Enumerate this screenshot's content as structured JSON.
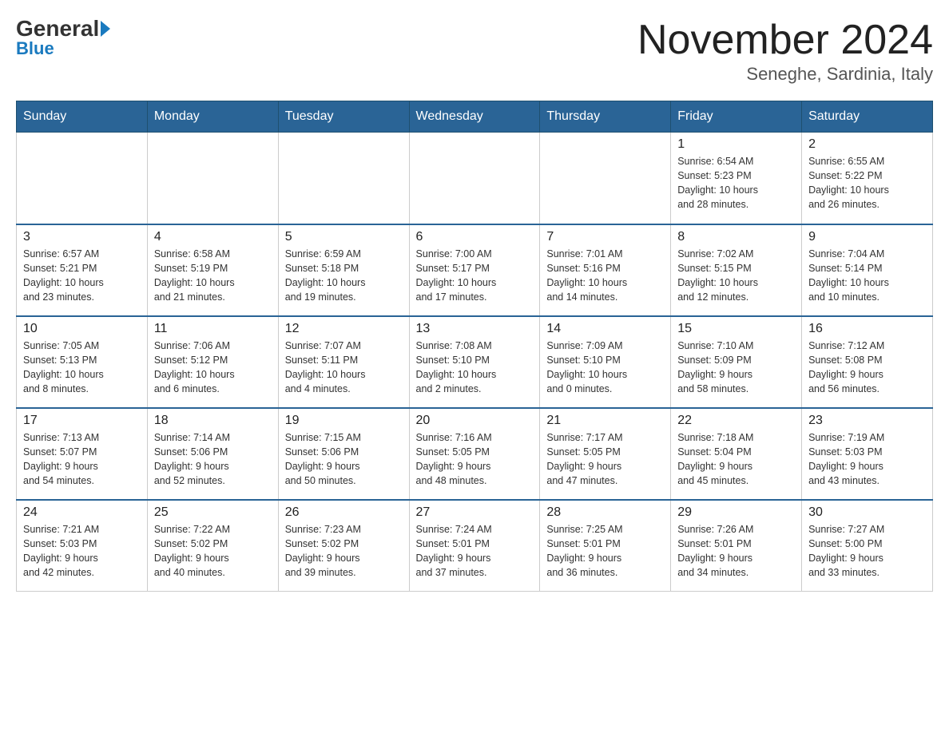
{
  "header": {
    "logo_general": "General",
    "logo_blue": "Blue",
    "month_title": "November 2024",
    "location": "Seneghe, Sardinia, Italy"
  },
  "days_of_week": [
    "Sunday",
    "Monday",
    "Tuesday",
    "Wednesday",
    "Thursday",
    "Friday",
    "Saturday"
  ],
  "weeks": [
    [
      {
        "day": "",
        "info": ""
      },
      {
        "day": "",
        "info": ""
      },
      {
        "day": "",
        "info": ""
      },
      {
        "day": "",
        "info": ""
      },
      {
        "day": "",
        "info": ""
      },
      {
        "day": "1",
        "info": "Sunrise: 6:54 AM\nSunset: 5:23 PM\nDaylight: 10 hours\nand 28 minutes."
      },
      {
        "day": "2",
        "info": "Sunrise: 6:55 AM\nSunset: 5:22 PM\nDaylight: 10 hours\nand 26 minutes."
      }
    ],
    [
      {
        "day": "3",
        "info": "Sunrise: 6:57 AM\nSunset: 5:21 PM\nDaylight: 10 hours\nand 23 minutes."
      },
      {
        "day": "4",
        "info": "Sunrise: 6:58 AM\nSunset: 5:19 PM\nDaylight: 10 hours\nand 21 minutes."
      },
      {
        "day": "5",
        "info": "Sunrise: 6:59 AM\nSunset: 5:18 PM\nDaylight: 10 hours\nand 19 minutes."
      },
      {
        "day": "6",
        "info": "Sunrise: 7:00 AM\nSunset: 5:17 PM\nDaylight: 10 hours\nand 17 minutes."
      },
      {
        "day": "7",
        "info": "Sunrise: 7:01 AM\nSunset: 5:16 PM\nDaylight: 10 hours\nand 14 minutes."
      },
      {
        "day": "8",
        "info": "Sunrise: 7:02 AM\nSunset: 5:15 PM\nDaylight: 10 hours\nand 12 minutes."
      },
      {
        "day": "9",
        "info": "Sunrise: 7:04 AM\nSunset: 5:14 PM\nDaylight: 10 hours\nand 10 minutes."
      }
    ],
    [
      {
        "day": "10",
        "info": "Sunrise: 7:05 AM\nSunset: 5:13 PM\nDaylight: 10 hours\nand 8 minutes."
      },
      {
        "day": "11",
        "info": "Sunrise: 7:06 AM\nSunset: 5:12 PM\nDaylight: 10 hours\nand 6 minutes."
      },
      {
        "day": "12",
        "info": "Sunrise: 7:07 AM\nSunset: 5:11 PM\nDaylight: 10 hours\nand 4 minutes."
      },
      {
        "day": "13",
        "info": "Sunrise: 7:08 AM\nSunset: 5:10 PM\nDaylight: 10 hours\nand 2 minutes."
      },
      {
        "day": "14",
        "info": "Sunrise: 7:09 AM\nSunset: 5:10 PM\nDaylight: 10 hours\nand 0 minutes."
      },
      {
        "day": "15",
        "info": "Sunrise: 7:10 AM\nSunset: 5:09 PM\nDaylight: 9 hours\nand 58 minutes."
      },
      {
        "day": "16",
        "info": "Sunrise: 7:12 AM\nSunset: 5:08 PM\nDaylight: 9 hours\nand 56 minutes."
      }
    ],
    [
      {
        "day": "17",
        "info": "Sunrise: 7:13 AM\nSunset: 5:07 PM\nDaylight: 9 hours\nand 54 minutes."
      },
      {
        "day": "18",
        "info": "Sunrise: 7:14 AM\nSunset: 5:06 PM\nDaylight: 9 hours\nand 52 minutes."
      },
      {
        "day": "19",
        "info": "Sunrise: 7:15 AM\nSunset: 5:06 PM\nDaylight: 9 hours\nand 50 minutes."
      },
      {
        "day": "20",
        "info": "Sunrise: 7:16 AM\nSunset: 5:05 PM\nDaylight: 9 hours\nand 48 minutes."
      },
      {
        "day": "21",
        "info": "Sunrise: 7:17 AM\nSunset: 5:05 PM\nDaylight: 9 hours\nand 47 minutes."
      },
      {
        "day": "22",
        "info": "Sunrise: 7:18 AM\nSunset: 5:04 PM\nDaylight: 9 hours\nand 45 minutes."
      },
      {
        "day": "23",
        "info": "Sunrise: 7:19 AM\nSunset: 5:03 PM\nDaylight: 9 hours\nand 43 minutes."
      }
    ],
    [
      {
        "day": "24",
        "info": "Sunrise: 7:21 AM\nSunset: 5:03 PM\nDaylight: 9 hours\nand 42 minutes."
      },
      {
        "day": "25",
        "info": "Sunrise: 7:22 AM\nSunset: 5:02 PM\nDaylight: 9 hours\nand 40 minutes."
      },
      {
        "day": "26",
        "info": "Sunrise: 7:23 AM\nSunset: 5:02 PM\nDaylight: 9 hours\nand 39 minutes."
      },
      {
        "day": "27",
        "info": "Sunrise: 7:24 AM\nSunset: 5:01 PM\nDaylight: 9 hours\nand 37 minutes."
      },
      {
        "day": "28",
        "info": "Sunrise: 7:25 AM\nSunset: 5:01 PM\nDaylight: 9 hours\nand 36 minutes."
      },
      {
        "day": "29",
        "info": "Sunrise: 7:26 AM\nSunset: 5:01 PM\nDaylight: 9 hours\nand 34 minutes."
      },
      {
        "day": "30",
        "info": "Sunrise: 7:27 AM\nSunset: 5:00 PM\nDaylight: 9 hours\nand 33 minutes."
      }
    ]
  ]
}
